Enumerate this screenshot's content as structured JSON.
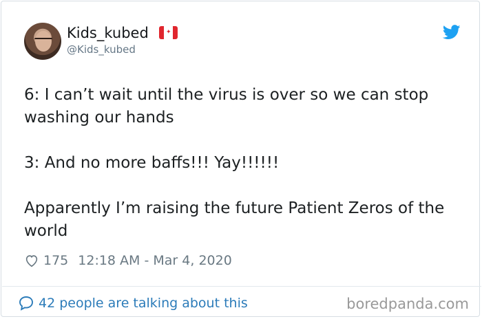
{
  "user": {
    "display_name": "Kids_kubed",
    "handle": "@Kids_kubed",
    "flag": "canada-flag-icon"
  },
  "tweet": {
    "lines": [
      "6:  I can’t wait until the virus is over so we can stop washing our hands",
      "3: And no more baffs!!! Yay!!!!!!",
      "Apparently I’m raising the future Patient Zeros of the world"
    ]
  },
  "meta": {
    "likes": "175",
    "timestamp": "12:18 AM - Mar 4, 2020"
  },
  "footer": {
    "conversation": "42 people are talking about this",
    "watermark": "boredpanda.com"
  },
  "colors": {
    "twitter_blue": "#1da1f2",
    "link_blue": "#2b7bb9",
    "muted": "#657786"
  }
}
